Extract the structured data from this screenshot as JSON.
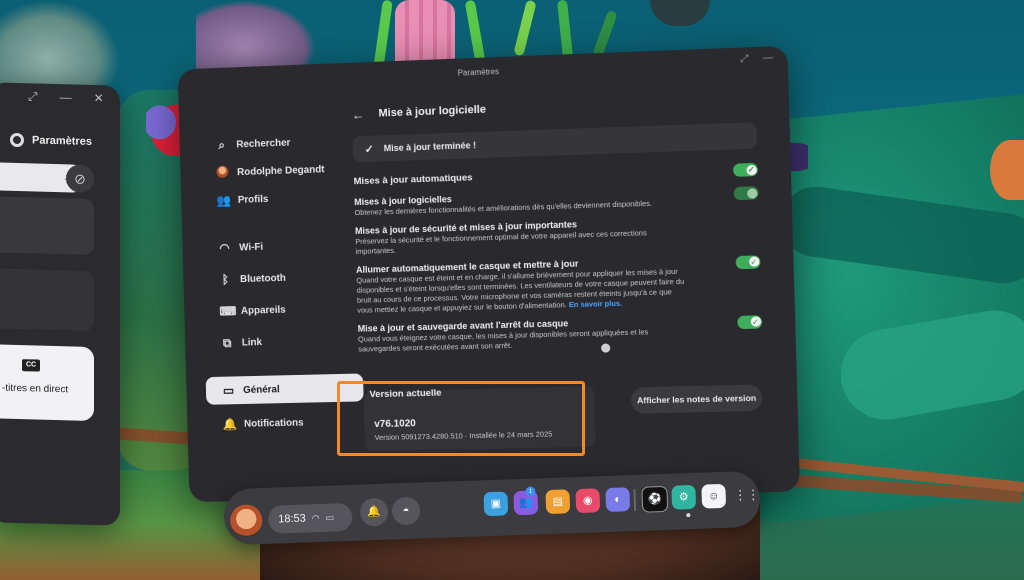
{
  "side_panel": {
    "title": "Paramètres",
    "captions_label": "-titres en direct",
    "cc_icon_label": "CC"
  },
  "window": {
    "title": "Paramètres"
  },
  "nav": {
    "items": [
      {
        "label": "Rechercher",
        "icon": "search-icon"
      },
      {
        "label": "Rodolphe Degandt",
        "icon": "avatar"
      },
      {
        "label": "Profils",
        "icon": "people-icon"
      },
      {
        "label": "Wi-Fi",
        "icon": "wifi-icon"
      },
      {
        "label": "Bluetooth",
        "icon": "bluetooth-icon"
      },
      {
        "label": "Appareils",
        "icon": "devices-icon"
      },
      {
        "label": "Link",
        "icon": "link-icon"
      },
      {
        "label": "Général",
        "icon": "headset-icon",
        "active": true
      },
      {
        "label": "Notifications",
        "icon": "bell-icon"
      }
    ]
  },
  "content": {
    "header": "Mise à jour logicielle",
    "done_text": "Mise à jour terminée !",
    "auto_updates_label": "Mises à jour automatiques",
    "rows": [
      {
        "title": "Mises à jour logicielles",
        "desc": "Obtenez les dernières fonctionnalités et améliorations dès qu'elles deviennent disponibles."
      },
      {
        "title": "Mises à jour de sécurité et mises à jour importantes",
        "desc": "Préservez la sécurité et le fonctionnement optimal de votre appareil avec ces corrections importantes."
      },
      {
        "title": "Allumer automatiquement le casque et mettre à jour",
        "desc": "Quand votre casque est éteint et en charge, il s'allume brièvement pour appliquer les mises à jour disponibles et s'éteint lorsqu'elles sont terminées. Les ventilateurs de votre casque peuvent faire du bruit au cours de ce processus. Votre microphone et vos caméras restent éteints jusqu'à ce que vous mettiez le casque et appuyiez sur le bouton d'alimentation.",
        "link": "En savoir plus."
      },
      {
        "title": "Mise à jour et sauvegarde avant l'arrêt du casque",
        "desc": "Quand vous éteignez votre casque, les mises à jour disponibles seront appliquées et les sauvegardes seront exécutées avant son arrêt."
      }
    ],
    "version": {
      "label": "Version actuelle",
      "number": "v76.1020",
      "detail": "Version 5091273.4280.510 · Installée le 24 mars 2025"
    },
    "release_notes_button": "Afficher les notes de version"
  },
  "taskbar": {
    "time": "18:53",
    "badge_count": "1",
    "apps": [
      "store-app-icon",
      "people-app-icon",
      "shop-app-icon",
      "camera-app-icon",
      "horizon-app-icon",
      "soccer-app-icon",
      "settings-app-icon",
      "creature-app-icon",
      "grid-icon"
    ]
  },
  "colors": {
    "accent_toggle": "#3fae5a",
    "highlight_box": "#f08a2a",
    "link": "#4aa3ff"
  }
}
